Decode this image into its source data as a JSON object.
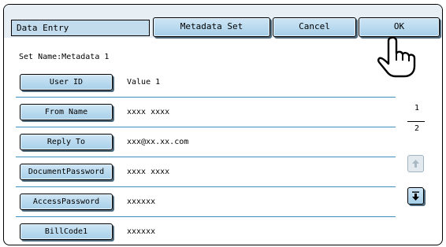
{
  "header": {
    "title": "Data Entry",
    "buttons": {
      "metadata_set": "Metadata Set",
      "cancel": "Cancel",
      "ok": "OK"
    }
  },
  "set_name": "Set Name:Metadata 1",
  "rows": [
    {
      "label": "User ID",
      "value": "Value 1"
    },
    {
      "label": "From Name",
      "value": "xxxx xxxx"
    },
    {
      "label": "Reply To",
      "value": "xxx@xx.xx.com"
    },
    {
      "label": "DocumentPassword",
      "value": "xxxx xxxx"
    },
    {
      "label": "AccessPassword",
      "value": "xxxxxx"
    },
    {
      "label": "BillCode1",
      "value": "xxxxxx"
    }
  ],
  "pager": {
    "current": "1",
    "total": "2",
    "up_icon": "arrow-up-icon",
    "down_icon": "arrow-down-icon"
  },
  "colors": {
    "button_fill": "#b6d9ee",
    "header_bg": "#e8eff4",
    "divider": "#3f8fbe"
  },
  "pointer_icon": "hand-pointer-icon"
}
